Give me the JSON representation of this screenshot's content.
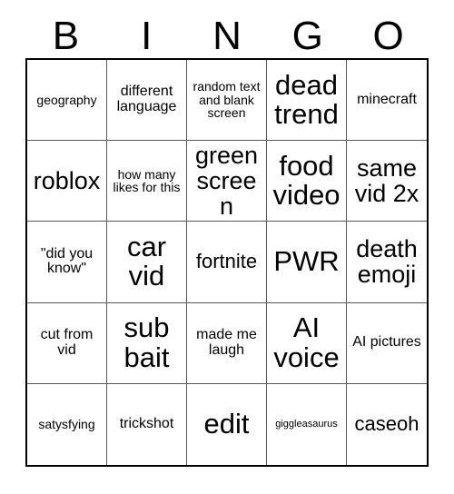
{
  "card": {
    "title": "BINGO",
    "headers": [
      "B",
      "I",
      "N",
      "G",
      "O"
    ],
    "colors": {
      "background": "#ffffff",
      "text": "#000000",
      "outer_border": "#000000",
      "inner_grid_line": "#5a5a5a"
    },
    "grid_size": "5x5",
    "rows": [
      [
        {
          "text": "geography",
          "size": "sm"
        },
        {
          "text": "different language",
          "size": "md"
        },
        {
          "text": "random text and blank screen",
          "size": "sm"
        },
        {
          "text": "dead trend",
          "size": "xxl"
        },
        {
          "text": "minecraft",
          "size": "md"
        }
      ],
      [
        {
          "text": "roblox",
          "size": "xl"
        },
        {
          "text": "how many likes for this",
          "size": "sm"
        },
        {
          "text": "green screen",
          "size": "xl"
        },
        {
          "text": "food video",
          "size": "xxl"
        },
        {
          "text": "same vid 2x",
          "size": "xl"
        }
      ],
      [
        {
          "text": "\"did you know\"",
          "size": "md"
        },
        {
          "text": "car vid",
          "size": "xxl"
        },
        {
          "text": "fortnite",
          "size": "lg"
        },
        {
          "text": "PWR",
          "size": "xxl"
        },
        {
          "text": "death emoji",
          "size": "xl"
        }
      ],
      [
        {
          "text": "cut from vid",
          "size": "md"
        },
        {
          "text": "sub bait",
          "size": "xxl"
        },
        {
          "text": "made me laugh",
          "size": "md"
        },
        {
          "text": "AI voice",
          "size": "xxl"
        },
        {
          "text": "AI pictures",
          "size": "md"
        }
      ],
      [
        {
          "text": "satysfying",
          "size": "sm"
        },
        {
          "text": "trickshot",
          "size": "md"
        },
        {
          "text": "edit",
          "size": "xxl"
        },
        {
          "text": "giggleasaurus",
          "size": "xs"
        },
        {
          "text": "caseoh",
          "size": "lg"
        }
      ]
    ]
  }
}
